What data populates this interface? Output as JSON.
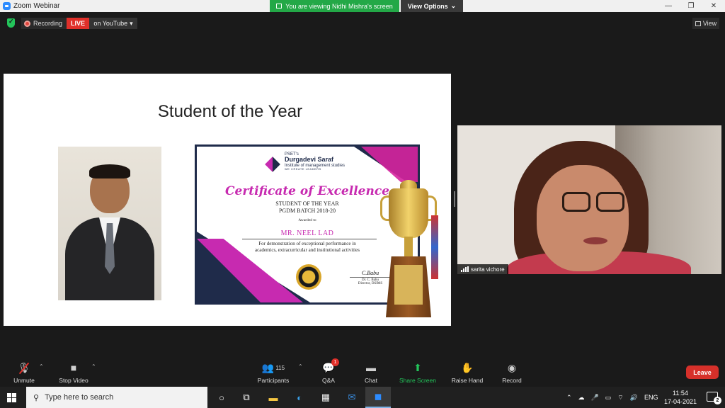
{
  "window": {
    "title": "Zoom Webinar",
    "viewing_banner": "You are viewing Nidhi Mishra's screen",
    "view_options": "View Options"
  },
  "status": {
    "recording": "Recording",
    "live": "LIVE",
    "youtube": "on YouTube",
    "view": "View"
  },
  "slide": {
    "title": "Student of  the Year",
    "certificate": {
      "inst_small": "PSET's",
      "inst_name": "Durgadevi Saraf",
      "inst_sub": "Institute of management studies",
      "inst_tag": "WE CREATE LEADERS",
      "heading": "Certificate of Excellence",
      "line1": "STUDENT OF THE YEAR",
      "line2": "PGDM BATCH 2018-20",
      "awarded": "Awarded to",
      "name": "MR. NEEL LAD",
      "desc1": "For demonstration of exceptional performance in",
      "desc2": "academics, extracurricular and institutional activities",
      "sig_mark": "C.Babu",
      "sig_name": "Dr. C. Babu",
      "sig_title": "Director, DSIMS"
    }
  },
  "participant": {
    "name": "sarita vichore"
  },
  "controls": {
    "unmute": "Unmute",
    "stop_video": "Stop Video",
    "participants": "Participants",
    "participants_count": "115",
    "qa": "Q&A",
    "qa_badge": "1",
    "chat": "Chat",
    "share_screen": "Share Screen",
    "raise_hand": "Raise Hand",
    "record": "Record",
    "leave": "Leave"
  },
  "taskbar": {
    "search_placeholder": "Type here to search",
    "lang": "ENG",
    "time": "11:54",
    "date": "17-04-2021",
    "notif_count": "2"
  },
  "colors": {
    "share_green": "#23c45a",
    "live_red": "#e0302a",
    "leave_red": "#d6302a",
    "banner_green": "#23a847",
    "cert_magenta": "#c72ab0",
    "cert_navy": "#1f2b4a"
  }
}
